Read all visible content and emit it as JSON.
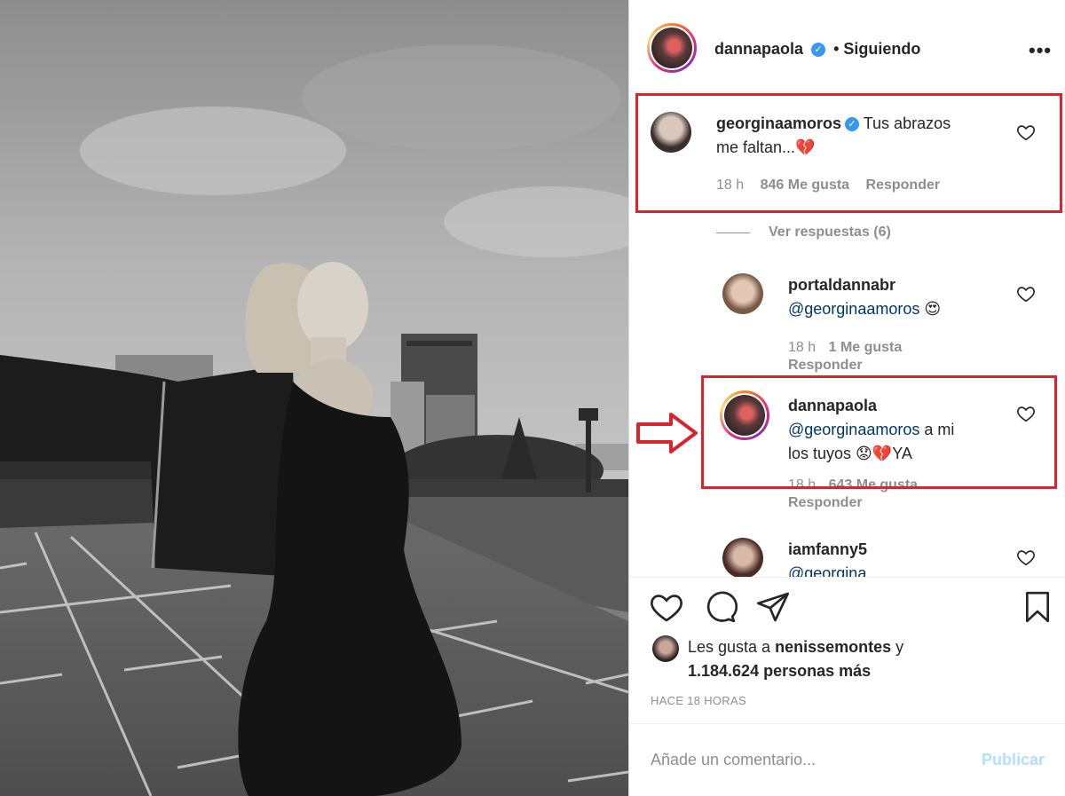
{
  "post": {
    "author": "dannapaola",
    "following_label": "• Siguiendo",
    "more_icon": "more-horizontal-icon"
  },
  "comments": [
    {
      "user": "georginaamoros",
      "verified": true,
      "text_line1": "Tus abrazos",
      "text_line2": "me faltan...",
      "emoji": "💔",
      "time": "18 h",
      "likes": "846 Me gusta",
      "reply": "Responder"
    }
  ],
  "view_replies": "Ver respuestas (6)",
  "replies": [
    {
      "user": "portaldannabr",
      "mention": "@georginaamoros",
      "text": "",
      "emoji": "😍",
      "time": "18 h",
      "likes": "1 Me gusta",
      "reply": "Responder"
    },
    {
      "user": "dannapaola",
      "mention": "@georginaamoros",
      "text_line1": " a mi",
      "text_line2": "los tuyos ",
      "emoji": "😟💔",
      "tail": "YA",
      "time": "18 h",
      "likes": "643 Me gusta",
      "reply": "Responder"
    },
    {
      "user": "iamfanny5",
      "mention": "@georgina..."
    }
  ],
  "actions": {
    "like_icon": "heart-icon",
    "comment_icon": "comment-icon",
    "share_icon": "paper-plane-icon",
    "save_icon": "bookmark-icon"
  },
  "likes_summary": {
    "prefix": "Les gusta a ",
    "user": "nenissemontes",
    "suffix": " y",
    "count": "1.184.624 personas más"
  },
  "timestamp": "HACE 18 HORAS",
  "add_comment": {
    "placeholder": "Añade un comentario...",
    "publish": "Publicar"
  },
  "colors": {
    "highlight": "#d9232d",
    "verified": "#3897f0",
    "link": "#00376b"
  }
}
